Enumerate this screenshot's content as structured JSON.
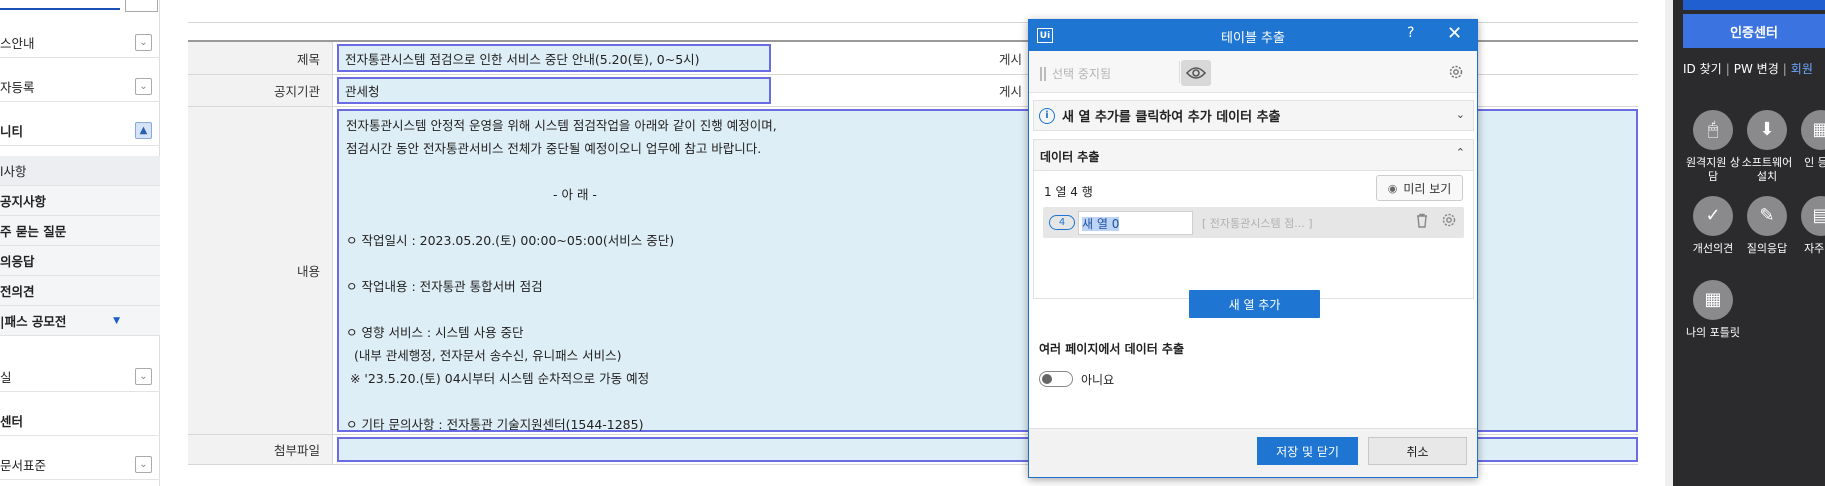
{
  "sidebar": {
    "items": [
      {
        "label": "스안내",
        "chevron": "down"
      },
      {
        "label": "자등록",
        "chevron": "down"
      },
      {
        "label": "니티",
        "chevron": "up"
      },
      {
        "label": "l사항",
        "chevron": ""
      },
      {
        "label": "공지사항",
        "chevron": ""
      },
      {
        "label": "주 묻는 질문",
        "chevron": ""
      },
      {
        "label": "의응답",
        "chevron": ""
      },
      {
        "label": "전의견",
        "chevron": ""
      },
      {
        "label": "|패스 공모전",
        "chevron": ""
      },
      {
        "label": "실",
        "chevron": "down"
      },
      {
        "label": "센터",
        "chevron": ""
      },
      {
        "label": "문서표준",
        "chevron": "down"
      }
    ]
  },
  "notice": {
    "title_label": "제목",
    "title_value": "전자통관시스템 점검으로 인한 서비스 중단 안내(5.20(토), 0~5시)",
    "agency_label": "공지기관",
    "agency_value": "관세청",
    "posted_label_1": "게시",
    "posted_label_2": "게시",
    "content_label": "내용",
    "content_lines": [
      "전자통관시스템 안정적 운영을 위해 시스템 점검작업을 아래와 같이 진행 예정이며,",
      "점검시간 동안 전자통관서비스 전체가 중단될 예정이오니 업무에 참고 바랍니다.",
      "- 아 래 -",
      "ㅇ 작업일시 : 2023.05.20.(토) 00:00~05:00(서비스 중단)",
      "ㅇ 작업내용 : 전자통관 통합서버 점검",
      "ㅇ 영향 서비스 : 시스템 사용 중단",
      "  (내부 관세행정, 전자문서 송수신, 유니패스 서비스)",
      " ※ '23.5.20.(토) 04시부터 시스템 순차적으로 가동 예정",
      "ㅇ 기타 문의사항 : 전자통관 기술지원센터(1544-1285)"
    ],
    "attachment_label": "첨부파일"
  },
  "right_panel": {
    "cert_button": "인증센터",
    "link_id": "ID 찾기",
    "link_pw": "PW 변경",
    "link_member": "회원",
    "icons": [
      {
        "label": "원격지원 상담",
        "icon": "remote-support-icon"
      },
      {
        "label": "소프트웨어 설치",
        "icon": "software-install-icon"
      },
      {
        "label": "인 등록",
        "icon": "register-icon"
      },
      {
        "label": "개선의견",
        "icon": "check-icon"
      },
      {
        "label": "질의응답",
        "icon": "qa-icon"
      },
      {
        "label": "자주 질",
        "icon": "faq-icon"
      },
      {
        "label": "나의 포틀릿",
        "icon": "portlet-icon"
      }
    ]
  },
  "dialog": {
    "title": "테이블 추출",
    "help": "?",
    "close": "✕",
    "stop_selection": "선택 중지됨",
    "info_text": "새 열 추가를 클릭하여 추가 데이터 추출",
    "data_section_title": "데이터 추출",
    "col_row_info": "1 열  4 행",
    "preview_button": "미리 보기",
    "column": {
      "badge": "4",
      "name": "새 열 0",
      "preview": "[ 전자통관시스템 점...  ]"
    },
    "add_column_button": "새 열 추가",
    "multi_page_label": "여러 페이지에서 데이터 추출",
    "toggle_label": "아니요",
    "toggle_on": false,
    "save_button": "저장 및 닫기",
    "cancel_button": "취소"
  },
  "colors": {
    "accent": "#1f76d2",
    "highlight_border": "#6b6be4",
    "highlight_fill": "#deeef6",
    "dark_panel": "#2b2b2d"
  }
}
